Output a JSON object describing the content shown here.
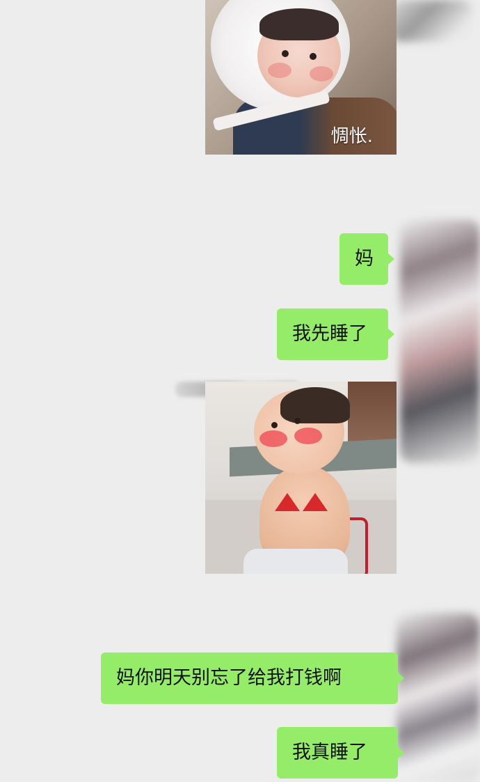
{
  "chat": {
    "messages": [
      {
        "type": "sticker",
        "caption": "惆怅."
      },
      {
        "type": "text",
        "text": "妈"
      },
      {
        "type": "text",
        "text": "我先睡了"
      },
      {
        "type": "sticker",
        "caption": ""
      },
      {
        "type": "text",
        "text": "妈你明天别忘了给我打钱啊"
      },
      {
        "type": "text",
        "text": "我真睡了"
      }
    ]
  },
  "colors": {
    "background": "#ededed",
    "self_bubble": "#95ec69",
    "text": "#111111"
  },
  "icons": [
    "avatar-blurred",
    "sender-name-blurred"
  ]
}
